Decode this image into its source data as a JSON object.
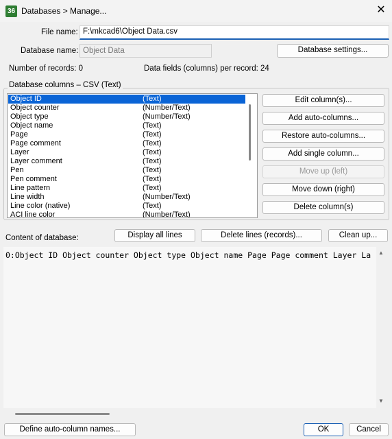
{
  "window": {
    "icon_text": "36",
    "title": "Databases > Manage...",
    "close_glyph": "✕"
  },
  "file": {
    "label": "File name:",
    "value": "F:\\mkcad6\\Object Data.csv"
  },
  "database": {
    "label": "Database name:",
    "value": "Object Data",
    "settings_button": "Database settings..."
  },
  "stats": {
    "records": "Number of records: 0",
    "fields": "Data fields (columns) per record: 24"
  },
  "columns_group": {
    "title": "Database columns – CSV (Text)",
    "rows": [
      {
        "name": "Object ID",
        "type": "(Text)"
      },
      {
        "name": "Object counter",
        "type": "(Number/Text)"
      },
      {
        "name": "Object type",
        "type": "(Number/Text)"
      },
      {
        "name": "Object name",
        "type": "(Text)"
      },
      {
        "name": "Page",
        "type": "(Text)"
      },
      {
        "name": "Page comment",
        "type": "(Text)"
      },
      {
        "name": "Layer",
        "type": "(Text)"
      },
      {
        "name": "Layer comment",
        "type": "(Text)"
      },
      {
        "name": "Pen",
        "type": "(Text)"
      },
      {
        "name": "Pen comment",
        "type": "(Text)"
      },
      {
        "name": "Line pattern",
        "type": "(Text)"
      },
      {
        "name": "Line width",
        "type": "(Number/Text)"
      },
      {
        "name": "Line color (native)",
        "type": "(Text)"
      },
      {
        "name": "ACI line color",
        "type": "(Number/Text)"
      }
    ],
    "buttons": {
      "edit": "Edit column(s)...",
      "add_auto": "Add auto-columns...",
      "restore_auto": "Restore auto-columns...",
      "add_single": "Add single column...",
      "move_up": "Move up (left)",
      "move_down": "Move down (right)",
      "delete": "Delete column(s)"
    }
  },
  "content": {
    "label": "Content of database:",
    "display_all": "Display all lines",
    "delete_lines": "Delete lines (records)...",
    "clean_up": "Clean up...",
    "text": "0:Object ID Object counter Object type Object name Page Page comment Layer La"
  },
  "footer": {
    "define_auto": "Define auto-column names...",
    "ok": "OK",
    "cancel": "Cancel"
  }
}
